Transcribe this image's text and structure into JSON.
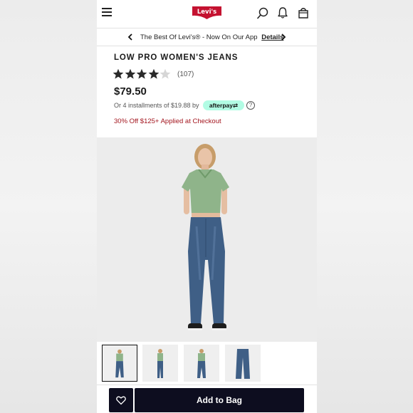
{
  "header": {
    "brand": "Levi's",
    "menu_icon": "hamburger-menu-icon",
    "search_icon": "search-icon",
    "notifications_icon": "bell-icon",
    "bag_icon": "shopping-bag-icon",
    "brand_color": "#c41230"
  },
  "promo": {
    "text": "The Best Of Levi's® - Now On Our App",
    "link": "Details"
  },
  "product": {
    "title": "LOW PRO WOMEN'S JEANS",
    "rating": 4,
    "rating_max": 5,
    "reviews": "(107)",
    "price": "$79.50",
    "installments": "Or 4 installments of $19.88 by",
    "afterpay_label": "afterpay",
    "discount": "30% Off $125+ Applied at Checkout"
  },
  "colors": {
    "discount_red": "#a3151e",
    "afterpay_mint": "#b2fce4",
    "button_navy": "#0d0d1f"
  },
  "actions": {
    "add_to_bag": "Add to Bag",
    "wishlist_icon": "heart-icon"
  }
}
